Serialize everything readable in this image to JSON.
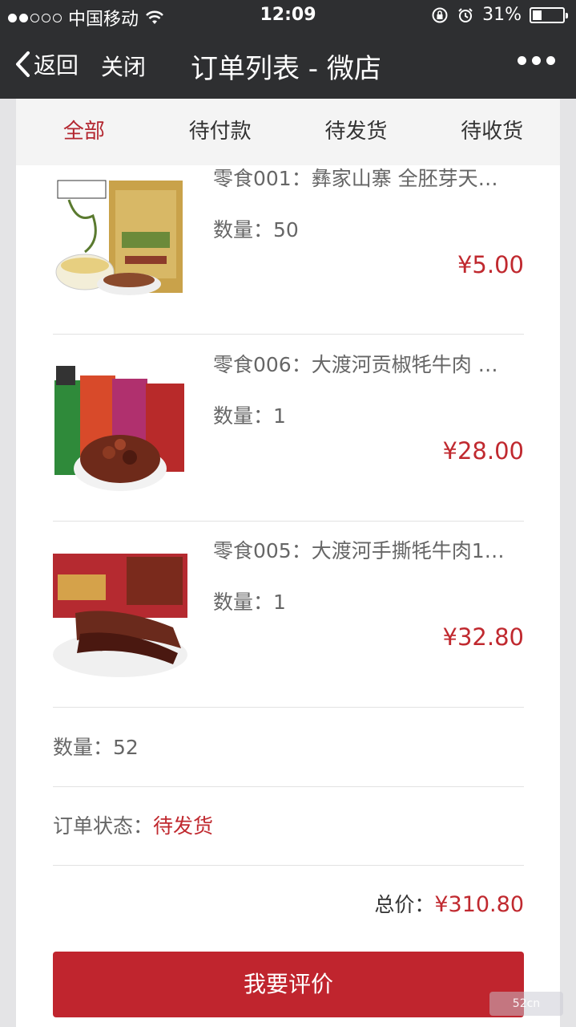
{
  "status": {
    "carrier": "中国移动",
    "time": "12:09",
    "battery": "31%",
    "battery_level": 0.31
  },
  "nav": {
    "back_label": "返回",
    "close_label": "关闭",
    "title": "订单列表 - 微店"
  },
  "tabs": [
    {
      "label": "全部",
      "active": true
    },
    {
      "label": "待付款",
      "active": false
    },
    {
      "label": "待发货",
      "active": false
    },
    {
      "label": "待收货",
      "active": false
    }
  ],
  "items": [
    {
      "name": "零食001：彝家山寨 全胚芽天…",
      "qty": "数量：50",
      "price": "¥5.00"
    },
    {
      "name": "零食006：大渡河贡椒牦牛肉 …",
      "qty": "数量：1",
      "price": "¥28.00"
    },
    {
      "name": "零食005：大渡河手撕牦牛肉1…",
      "qty": "数量：1",
      "price": "¥32.80"
    }
  ],
  "summary": {
    "total_qty": "数量：52",
    "status_label": "订单状态：",
    "status_value": "待发货",
    "total_label": "总价：",
    "total_value": "¥310.80"
  },
  "action": {
    "label": "我要评价"
  },
  "colors": {
    "accent": "#c0252e",
    "navbar": "#2e2f31"
  }
}
